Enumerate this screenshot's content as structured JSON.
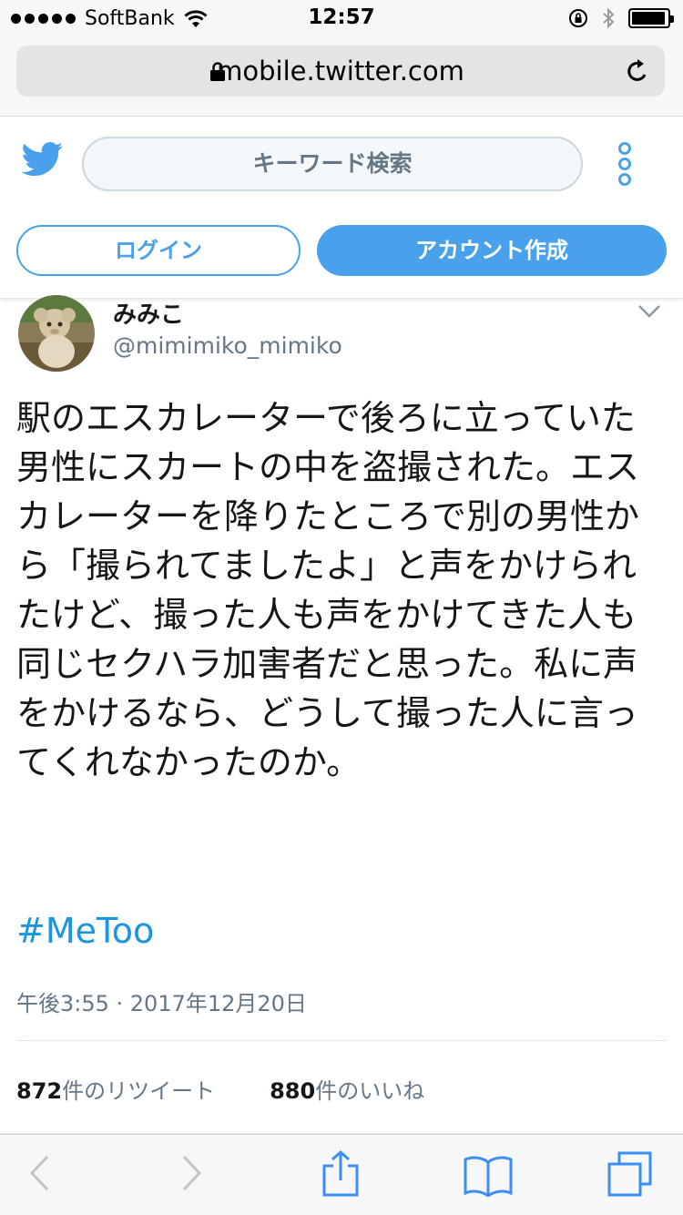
{
  "status_bar": {
    "carrier": "SoftBank",
    "time": "12:57",
    "signal_bars": 5,
    "battery_level": 0.95
  },
  "browser": {
    "url": "mobile.twitter.com"
  },
  "twitter_header": {
    "search_placeholder": "キーワード検索",
    "login_label": "ログイン",
    "signup_label": "アカウント作成",
    "brand_color": "#4aa1eb"
  },
  "tweet": {
    "display_name": "みみこ",
    "handle": "@mimimiko_mimiko",
    "text": "駅のエスカレーターで後ろに立っていた男性にスカートの中を盗撮された。エスカレーターを降りたところで別の男性から「撮られてましたよ」と声をかけられたけど、撮った人も声をかけてきた人も同じセクハラ加害者だと思った。私に声をかけるなら、どうして撮った人に言ってくれなかったのか。",
    "hashtag": "#MeToo",
    "timestamp": "午後3:55 · 2017年12月20日",
    "retweets": {
      "count": "872",
      "label": "件のリツイート"
    },
    "likes": {
      "count": "880",
      "label": "件のいいね"
    }
  },
  "toolbar": {
    "icons": [
      "back-icon",
      "forward-icon",
      "share-icon",
      "bookmarks-icon",
      "tabs-icon"
    ]
  }
}
